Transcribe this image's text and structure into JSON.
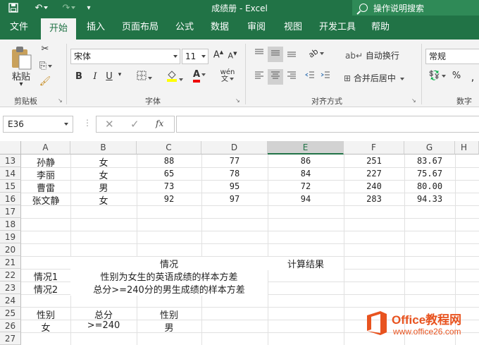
{
  "titlebar": {
    "title": "成绩册  -  Excel",
    "tell_me": "操作说明搜索"
  },
  "ribbon_tabs": [
    "文件",
    "开始",
    "插入",
    "页面布局",
    "公式",
    "数据",
    "审阅",
    "视图",
    "开发工具",
    "帮助"
  ],
  "ribbon": {
    "paste_label": "粘贴",
    "clipboard_label": "剪贴板",
    "font_name": "宋体",
    "font_size": "11",
    "font_group_label": "字体",
    "bold": "B",
    "italic": "I",
    "underline": "U",
    "wrap_text": "自动换行",
    "merge_center": "合并后居中",
    "align_group_label": "对齐方式",
    "number_format": "常规",
    "number_group_label": "数字",
    "percent": "%"
  },
  "formula_bar": {
    "name_box": "E36",
    "fx": "fx",
    "formula": ""
  },
  "grid": {
    "columns": [
      "A",
      "B",
      "C",
      "D",
      "E",
      "F",
      "G",
      "H"
    ],
    "selected_column": "E",
    "rows": [
      13,
      14,
      15,
      16,
      17,
      18,
      19,
      20,
      21,
      22,
      23,
      24,
      25,
      26,
      27
    ],
    "data_rows": [
      [
        "孙静",
        "女",
        "88",
        "77",
        "86",
        "251",
        "83.67"
      ],
      [
        "李丽",
        "女",
        "65",
        "78",
        "84",
        "227",
        "75.67"
      ],
      [
        "曹雷",
        "男",
        "73",
        "95",
        "72",
        "240",
        "80.00"
      ],
      [
        "张文静",
        "女",
        "92",
        "97",
        "94",
        "283",
        "94.33"
      ]
    ],
    "r21_situation": "情况",
    "r21_result": "计算结果",
    "r22_label": "情况1",
    "r22_text": "性别为女生的英语成绩的样本方差",
    "r23_label": "情况2",
    "r23_text": "总分>=240分的男生成绩的样本方差",
    "r25": [
      "性别",
      "总分",
      "性别"
    ],
    "r26": [
      "女",
      ">=240",
      "男"
    ]
  },
  "watermark": {
    "brand": "Office教程网",
    "url": "www.office26.com"
  }
}
